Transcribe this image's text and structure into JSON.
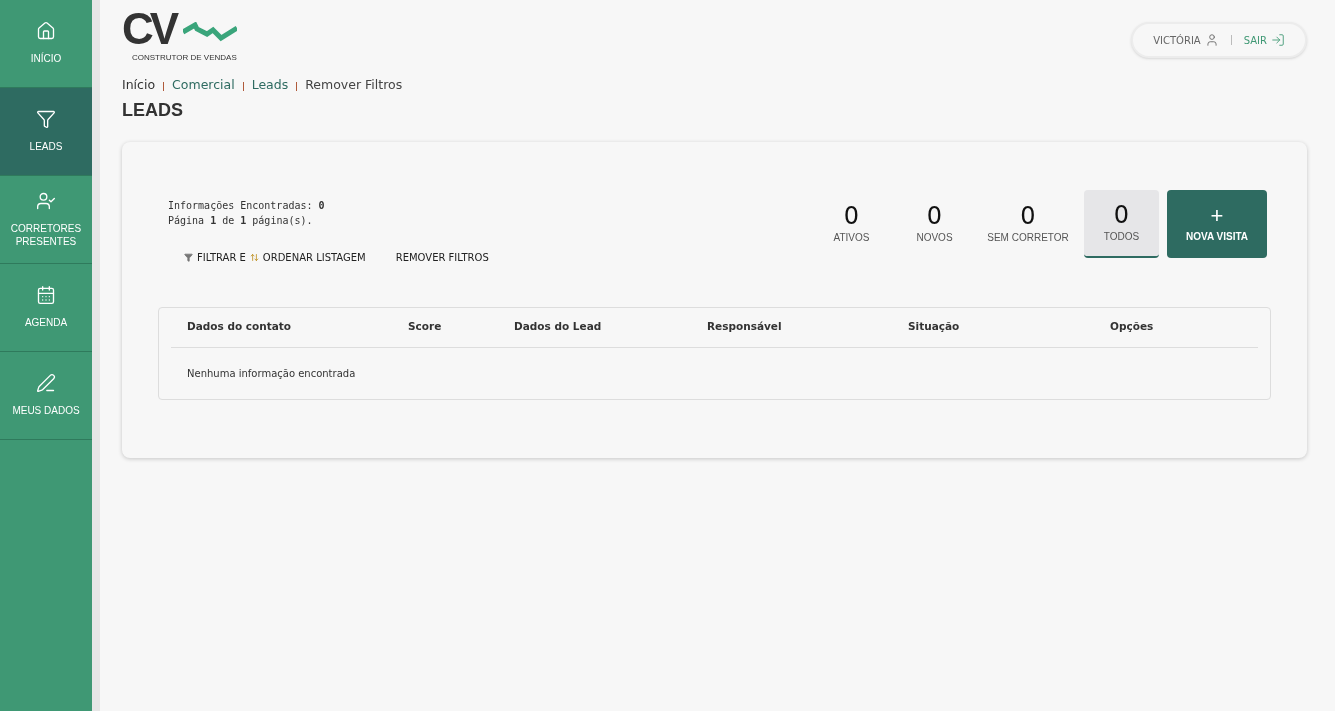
{
  "sidebar": {
    "items": [
      {
        "label": "INÍCIO",
        "selected": false
      },
      {
        "label": "LEADS",
        "selected": true
      },
      {
        "label": "CORRETORES PRESENTES",
        "selected": false
      },
      {
        "label": "AGENDA",
        "selected": false
      },
      {
        "label": "MEUS DADOS",
        "selected": false
      }
    ]
  },
  "logo": {
    "mark": "CV",
    "tagline": "CONSTRUTOR DE VENDAS"
  },
  "user_menu": {
    "user": "VICTÓRIA",
    "logout": "SAIR"
  },
  "breadcrumb": [
    "Início",
    "Comercial",
    "Leads",
    "Remover Filtros"
  ],
  "page_title": "LEADS",
  "info": [
    "Informações Encontradas: **0**",
    "Página **1** de **1** página(s)."
  ],
  "actions": {
    "filter_part_1": "FILTRAR E",
    "filter_part_2": "ORDENAR LISTAGEM",
    "remove_filters": "REMOVER FILTROS"
  },
  "stats": [
    {
      "count": "0",
      "label": "ATIVOS",
      "selected": false
    },
    {
      "count": "0",
      "label": "NOVOS",
      "selected": false
    },
    {
      "count": "0",
      "label": "SEM CORRETOR",
      "selected": false
    },
    {
      "count": "0",
      "label": "TODOS",
      "selected": true
    }
  ],
  "new_visit": {
    "symbol": "+",
    "label": "NOVA VISITA"
  },
  "table": {
    "columns": [
      "Dados do contato",
      "Score",
      "Dados do Lead",
      "Responsável",
      "Situação",
      "Opções"
    ],
    "empty_message": "Nenhuma informação encontrada"
  }
}
